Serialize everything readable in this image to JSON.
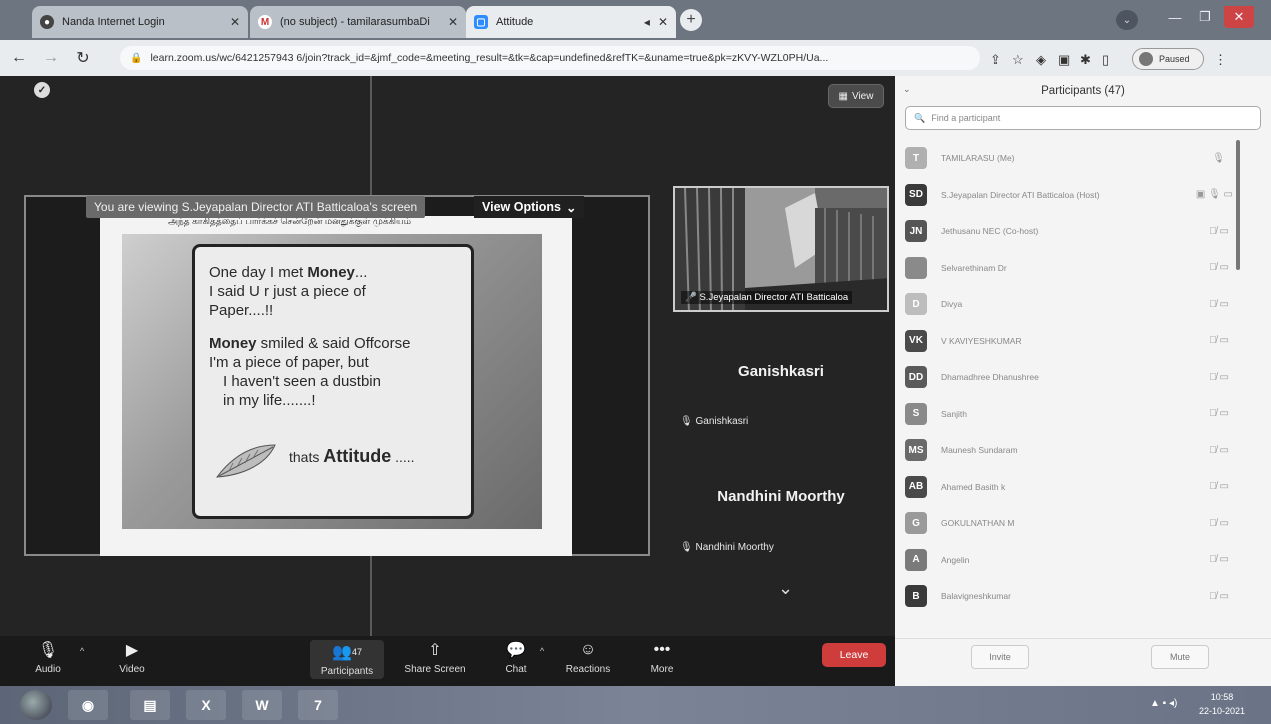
{
  "browser": {
    "tabs": [
      {
        "label": "Nanda Internet Login",
        "favicon": "globe-icon",
        "active": false
      },
      {
        "label": "(no subject) - tamilarasumbaDi",
        "favicon": "gmail-icon",
        "active": false
      },
      {
        "label": "Attitude",
        "favicon": "zoom-icon",
        "active": true
      }
    ],
    "url": "learn.zoom.us/wc/6421257943 6/join?track_id=&jmf_code=&meeting_result=&tk=&cap=undefined&refTK=&uname=true&pk=zKVY-WZL0PH/Ua...",
    "profile_label": "Paused"
  },
  "meeting": {
    "view_button": "View",
    "viewing_banner": "You are viewing S.Jeyapalan Director ATI Batticaloa's screen",
    "view_options": "View Options",
    "slide": {
      "tamil_header": "அந்த காகிதத்தைப் பார்க்கச் சென்றேன் மனதுக்குள் முக்கியம்",
      "lines": [
        {
          "plain": "One day I met ",
          "bold": "Money",
          "tail": "..."
        },
        {
          "plain": "I said U r just a piece of",
          "bold": "",
          "tail": ""
        },
        {
          "plain": "Paper....!!",
          "bold": "",
          "tail": ""
        },
        {
          "plain": "",
          "bold": "Money",
          "tail": " smiled & said Offcorse"
        },
        {
          "plain": "I'm a piece of paper, but",
          "bold": "",
          "tail": ""
        },
        {
          "plain": "  I haven't seen a dustbin",
          "bold": "",
          "tail": ""
        },
        {
          "plain": "  in my life.......!",
          "bold": "",
          "tail": ""
        }
      ],
      "attitude_prefix": "thats ",
      "attitude_bold": "Attitude",
      "attitude_suffix": " ....."
    },
    "camera_tile_name": "S.Jeyapalan Director ATI Batticaloa",
    "participant_tiles": [
      {
        "display_name": "Ganishkasri",
        "label": "Ganishkasri"
      },
      {
        "display_name": "Nandhini Moorthy",
        "label": "Nandhini Moorthy"
      }
    ]
  },
  "zoom_toolbar": {
    "audio": "Audio",
    "video": "Video",
    "participants": "Participants",
    "participants_count": "47",
    "share_screen": "Share Screen",
    "chat": "Chat",
    "reactions": "Reactions",
    "more": "More",
    "leave": "Leave"
  },
  "participants_panel": {
    "title": "Participants (47)",
    "search_placeholder": "Find a participant",
    "invite": "Invite",
    "mute": "Mute",
    "items": [
      {
        "initials": "T",
        "name": "TAMILARASU (Me)",
        "color": "#b0b0b0"
      },
      {
        "initials": "SD",
        "name": "S.Jeyapalan Director ATI Batticaloa (Host)",
        "color": "#3a3a3a"
      },
      {
        "initials": "JN",
        "name": "Jethusanu NEC (Co-host)",
        "color": "#555555"
      },
      {
        "initials": "",
        "name": "Selvarethinam Dr",
        "color": "#8a8a8a"
      },
      {
        "initials": "D",
        "name": "Divya",
        "color": "#bdbdbd"
      },
      {
        "initials": "VK",
        "name": "V KAVIYESHKUMAR",
        "color": "#4a4a4a"
      },
      {
        "initials": "DD",
        "name": "Dhamadhree Dhanushree",
        "color": "#5a5a5a"
      },
      {
        "initials": "S",
        "name": "Sanjith",
        "color": "#8a8a8a"
      },
      {
        "initials": "MS",
        "name": "Maunesh Sundaram",
        "color": "#6a6a6a"
      },
      {
        "initials": "AB",
        "name": "Ahamed Basith k",
        "color": "#4a4a4a"
      },
      {
        "initials": "G",
        "name": "GOKULNATHAN M",
        "color": "#9a9a9a"
      },
      {
        "initials": "A",
        "name": "Angelin",
        "color": "#7a7a7a"
      },
      {
        "initials": "B",
        "name": "Balavigneshkumar",
        "color": "#3a3a3a"
      }
    ]
  },
  "taskbar": {
    "time": "10:58",
    "date": "22-10-2021"
  }
}
